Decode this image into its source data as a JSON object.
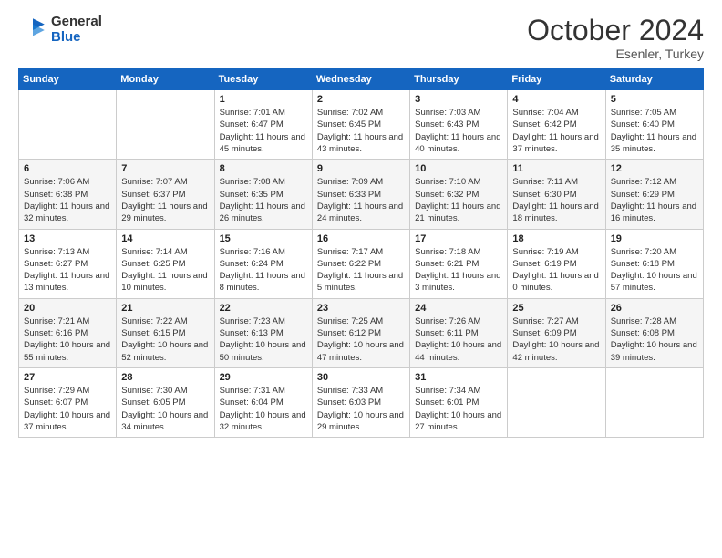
{
  "header": {
    "logo_general": "General",
    "logo_blue": "Blue",
    "month_title": "October 2024",
    "subtitle": "Esenler, Turkey"
  },
  "days_of_week": [
    "Sunday",
    "Monday",
    "Tuesday",
    "Wednesday",
    "Thursday",
    "Friday",
    "Saturday"
  ],
  "weeks": [
    [
      {
        "day": "",
        "sunrise": "",
        "sunset": "",
        "daylight": ""
      },
      {
        "day": "",
        "sunrise": "",
        "sunset": "",
        "daylight": ""
      },
      {
        "day": "1",
        "sunrise": "Sunrise: 7:01 AM",
        "sunset": "Sunset: 6:47 PM",
        "daylight": "Daylight: 11 hours and 45 minutes."
      },
      {
        "day": "2",
        "sunrise": "Sunrise: 7:02 AM",
        "sunset": "Sunset: 6:45 PM",
        "daylight": "Daylight: 11 hours and 43 minutes."
      },
      {
        "day": "3",
        "sunrise": "Sunrise: 7:03 AM",
        "sunset": "Sunset: 6:43 PM",
        "daylight": "Daylight: 11 hours and 40 minutes."
      },
      {
        "day": "4",
        "sunrise": "Sunrise: 7:04 AM",
        "sunset": "Sunset: 6:42 PM",
        "daylight": "Daylight: 11 hours and 37 minutes."
      },
      {
        "day": "5",
        "sunrise": "Sunrise: 7:05 AM",
        "sunset": "Sunset: 6:40 PM",
        "daylight": "Daylight: 11 hours and 35 minutes."
      }
    ],
    [
      {
        "day": "6",
        "sunrise": "Sunrise: 7:06 AM",
        "sunset": "Sunset: 6:38 PM",
        "daylight": "Daylight: 11 hours and 32 minutes."
      },
      {
        "day": "7",
        "sunrise": "Sunrise: 7:07 AM",
        "sunset": "Sunset: 6:37 PM",
        "daylight": "Daylight: 11 hours and 29 minutes."
      },
      {
        "day": "8",
        "sunrise": "Sunrise: 7:08 AM",
        "sunset": "Sunset: 6:35 PM",
        "daylight": "Daylight: 11 hours and 26 minutes."
      },
      {
        "day": "9",
        "sunrise": "Sunrise: 7:09 AM",
        "sunset": "Sunset: 6:33 PM",
        "daylight": "Daylight: 11 hours and 24 minutes."
      },
      {
        "day": "10",
        "sunrise": "Sunrise: 7:10 AM",
        "sunset": "Sunset: 6:32 PM",
        "daylight": "Daylight: 11 hours and 21 minutes."
      },
      {
        "day": "11",
        "sunrise": "Sunrise: 7:11 AM",
        "sunset": "Sunset: 6:30 PM",
        "daylight": "Daylight: 11 hours and 18 minutes."
      },
      {
        "day": "12",
        "sunrise": "Sunrise: 7:12 AM",
        "sunset": "Sunset: 6:29 PM",
        "daylight": "Daylight: 11 hours and 16 minutes."
      }
    ],
    [
      {
        "day": "13",
        "sunrise": "Sunrise: 7:13 AM",
        "sunset": "Sunset: 6:27 PM",
        "daylight": "Daylight: 11 hours and 13 minutes."
      },
      {
        "day": "14",
        "sunrise": "Sunrise: 7:14 AM",
        "sunset": "Sunset: 6:25 PM",
        "daylight": "Daylight: 11 hours and 10 minutes."
      },
      {
        "day": "15",
        "sunrise": "Sunrise: 7:16 AM",
        "sunset": "Sunset: 6:24 PM",
        "daylight": "Daylight: 11 hours and 8 minutes."
      },
      {
        "day": "16",
        "sunrise": "Sunrise: 7:17 AM",
        "sunset": "Sunset: 6:22 PM",
        "daylight": "Daylight: 11 hours and 5 minutes."
      },
      {
        "day": "17",
        "sunrise": "Sunrise: 7:18 AM",
        "sunset": "Sunset: 6:21 PM",
        "daylight": "Daylight: 11 hours and 3 minutes."
      },
      {
        "day": "18",
        "sunrise": "Sunrise: 7:19 AM",
        "sunset": "Sunset: 6:19 PM",
        "daylight": "Daylight: 11 hours and 0 minutes."
      },
      {
        "day": "19",
        "sunrise": "Sunrise: 7:20 AM",
        "sunset": "Sunset: 6:18 PM",
        "daylight": "Daylight: 10 hours and 57 minutes."
      }
    ],
    [
      {
        "day": "20",
        "sunrise": "Sunrise: 7:21 AM",
        "sunset": "Sunset: 6:16 PM",
        "daylight": "Daylight: 10 hours and 55 minutes."
      },
      {
        "day": "21",
        "sunrise": "Sunrise: 7:22 AM",
        "sunset": "Sunset: 6:15 PM",
        "daylight": "Daylight: 10 hours and 52 minutes."
      },
      {
        "day": "22",
        "sunrise": "Sunrise: 7:23 AM",
        "sunset": "Sunset: 6:13 PM",
        "daylight": "Daylight: 10 hours and 50 minutes."
      },
      {
        "day": "23",
        "sunrise": "Sunrise: 7:25 AM",
        "sunset": "Sunset: 6:12 PM",
        "daylight": "Daylight: 10 hours and 47 minutes."
      },
      {
        "day": "24",
        "sunrise": "Sunrise: 7:26 AM",
        "sunset": "Sunset: 6:11 PM",
        "daylight": "Daylight: 10 hours and 44 minutes."
      },
      {
        "day": "25",
        "sunrise": "Sunrise: 7:27 AM",
        "sunset": "Sunset: 6:09 PM",
        "daylight": "Daylight: 10 hours and 42 minutes."
      },
      {
        "day": "26",
        "sunrise": "Sunrise: 7:28 AM",
        "sunset": "Sunset: 6:08 PM",
        "daylight": "Daylight: 10 hours and 39 minutes."
      }
    ],
    [
      {
        "day": "27",
        "sunrise": "Sunrise: 7:29 AM",
        "sunset": "Sunset: 6:07 PM",
        "daylight": "Daylight: 10 hours and 37 minutes."
      },
      {
        "day": "28",
        "sunrise": "Sunrise: 7:30 AM",
        "sunset": "Sunset: 6:05 PM",
        "daylight": "Daylight: 10 hours and 34 minutes."
      },
      {
        "day": "29",
        "sunrise": "Sunrise: 7:31 AM",
        "sunset": "Sunset: 6:04 PM",
        "daylight": "Daylight: 10 hours and 32 minutes."
      },
      {
        "day": "30",
        "sunrise": "Sunrise: 7:33 AM",
        "sunset": "Sunset: 6:03 PM",
        "daylight": "Daylight: 10 hours and 29 minutes."
      },
      {
        "day": "31",
        "sunrise": "Sunrise: 7:34 AM",
        "sunset": "Sunset: 6:01 PM",
        "daylight": "Daylight: 10 hours and 27 minutes."
      },
      {
        "day": "",
        "sunrise": "",
        "sunset": "",
        "daylight": ""
      },
      {
        "day": "",
        "sunrise": "",
        "sunset": "",
        "daylight": ""
      }
    ]
  ]
}
